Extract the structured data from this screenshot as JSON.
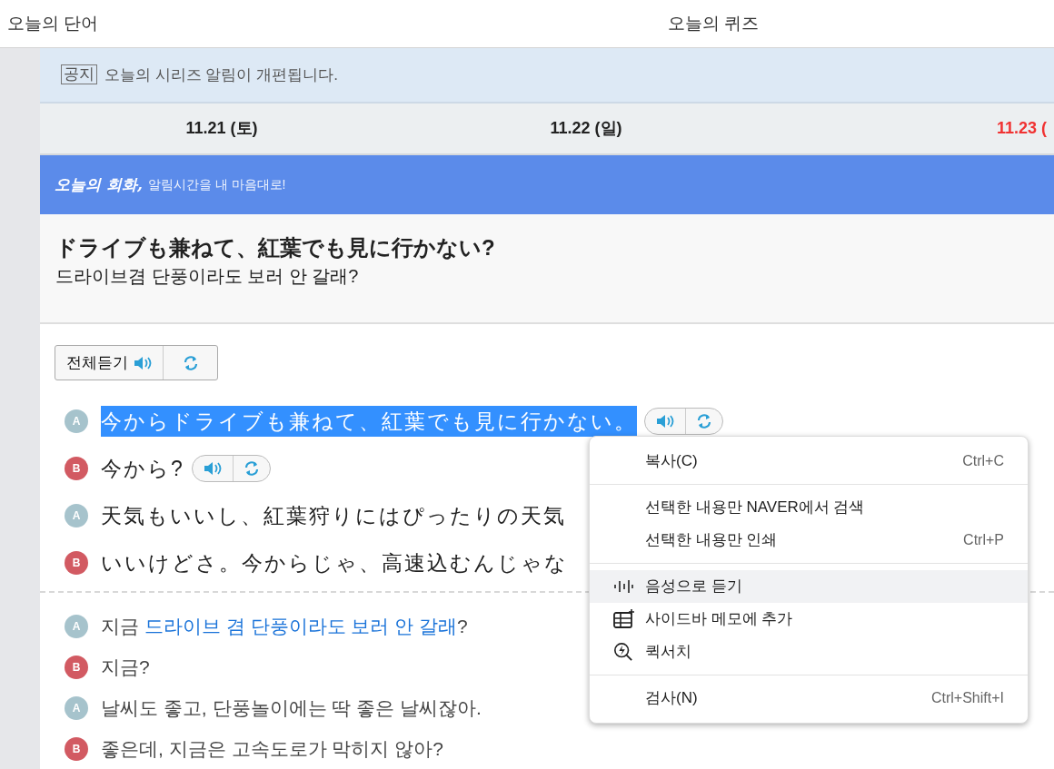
{
  "tabs": [
    {
      "label": "오늘의 단어",
      "selected": false
    },
    {
      "label": "오늘의 퀴즈",
      "selected": false
    }
  ],
  "notice": {
    "tag": "공지",
    "text": "오늘의 시리즈 알림이 개편됩니다."
  },
  "dates": [
    {
      "label": "11.21 (토)",
      "holiday": false
    },
    {
      "label": "11.22 (일)",
      "holiday": false
    },
    {
      "label": "11.23 (",
      "holiday": true
    }
  ],
  "banner": {
    "title": "오늘의 회화,",
    "subtitle": "알림시간을 내 마음대로!"
  },
  "headline": {
    "japanese": "ドライブも兼ねて、紅葉でも見に行かない?",
    "korean": "드라이브겸 단풍이라도 보러 안 갈래?"
  },
  "listen_all": {
    "label": "전체듣기"
  },
  "dialogue": [
    {
      "speaker": "A",
      "text": "今からドライブも兼ねて、紅葉でも見に行かない。",
      "highlighted": true,
      "audio": true
    },
    {
      "speaker": "B",
      "text": "今から?",
      "highlighted": false,
      "audio": true
    },
    {
      "speaker": "A",
      "text": "天気もいいし、紅葉狩りにはぴったりの天気",
      "highlighted": false,
      "audio": false
    },
    {
      "speaker": "B",
      "text": "いいけどさ。今からじゃ、高速込むんじゃな",
      "highlighted": false,
      "audio": false
    }
  ],
  "translation": [
    {
      "speaker": "A",
      "parts": [
        {
          "text": "지금 ",
          "emphasis": false
        },
        {
          "text": "드라이브 겸 단풍이라도 보러 안 갈래",
          "emphasis": true
        },
        {
          "text": "?",
          "emphasis": false
        }
      ]
    },
    {
      "speaker": "B",
      "parts": [
        {
          "text": "지금?",
          "emphasis": false
        }
      ]
    },
    {
      "speaker": "A",
      "parts": [
        {
          "text": "날씨도 좋고, 단풍놀이에는 딱 좋은 날씨잖아.",
          "emphasis": false
        }
      ]
    },
    {
      "speaker": "B",
      "parts": [
        {
          "text": "좋은데, 지금은 고속도로가 막히지 않아?",
          "emphasis": false
        }
      ]
    }
  ],
  "context_menu": {
    "groups": [
      [
        {
          "label": "복사(C)",
          "shortcut": "Ctrl+C",
          "kind": "plain",
          "highlighted": false
        }
      ],
      [
        {
          "label": "선택한 내용만 NAVER에서 검색",
          "kind": "plain",
          "highlighted": false
        },
        {
          "label": "선택한 내용만 인쇄",
          "shortcut": "Ctrl+P",
          "kind": "plain",
          "highlighted": false
        }
      ],
      [
        {
          "label": "음성으로 듣기",
          "kind": "listen",
          "highlighted": true
        },
        {
          "label": "사이드바 메모에 추가",
          "kind": "memo",
          "highlighted": false
        },
        {
          "label": "퀵서치",
          "kind": "quicksearch",
          "highlighted": false
        }
      ],
      [
        {
          "label": "검사(N)",
          "shortcut": "Ctrl+Shift+I",
          "kind": "plain",
          "highlighted": false
        }
      ]
    ]
  }
}
